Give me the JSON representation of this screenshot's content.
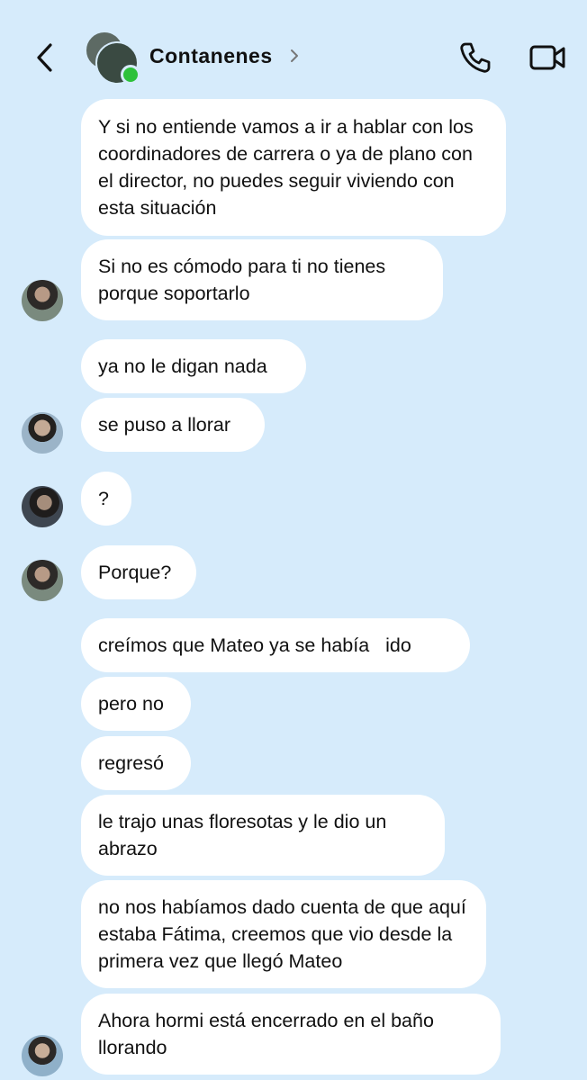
{
  "header": {
    "title": "Contanenes",
    "back_icon": "chevron-left-icon",
    "title_chevron_icon": "chevron-right-icon",
    "call_icon": "phone-icon",
    "video_icon": "video-camera-icon",
    "online_color": "#2dc13a"
  },
  "messages": [
    {
      "text": "Y si no entiende vamos a ir a hablar con los coordinadores de carrera o ya de plano con el director, no puedes seguir viviendo con esta situación"
    },
    {
      "text": "Si no es cómodo para ti no tienes porque soportarlo"
    },
    {
      "text": "ya no le digan nada"
    },
    {
      "text": "se puso a llorar"
    },
    {
      "text": "?"
    },
    {
      "text": "Porque?"
    },
    {
      "text": "creímos que Mateo ya se había   ido"
    },
    {
      "text": "pero no"
    },
    {
      "text": "regresó"
    },
    {
      "text": "le trajo unas floresotas y le dio un abrazo"
    },
    {
      "text": "no nos habíamos dado cuenta de que aquí estaba Fátima, creemos que vio desde la primera vez que llegó Mateo"
    },
    {
      "text": "Ahora hormi está encerrado en el baño llorando"
    }
  ],
  "colors": {
    "background": "#d6ebfb",
    "bubble": "#ffffff",
    "text": "#111111"
  }
}
